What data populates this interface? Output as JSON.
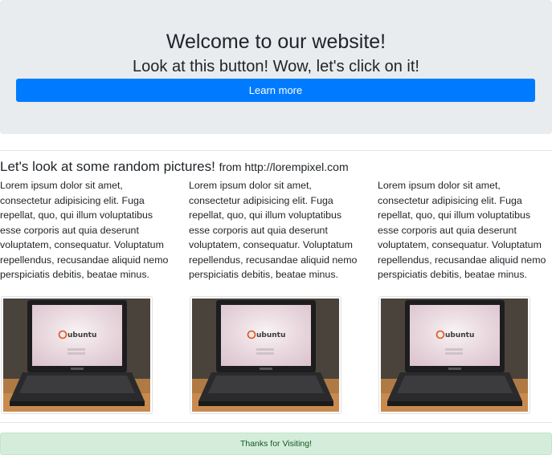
{
  "hero": {
    "title": "Welcome to our website!",
    "subtitle": "Look at this button! Wow, let's click on it!",
    "button_label": "Learn more",
    "button_color": "#007bff"
  },
  "gallery": {
    "heading": "Let's look at some random pictures!",
    "heading_source": "from http://lorempixel.com",
    "columns": [
      {
        "text": "Lorem ipsum dolor sit amet, consectetur adipisicing elit. Fuga repellat, quo, qui illum voluptatibus esse corporis aut quia deserunt voluptatem, consequatur. Voluptatum repellendus, recusandae aliquid nemo perspiciatis debitis, beatae minus.",
        "image_brand": "ubuntu"
      },
      {
        "text": "Lorem ipsum dolor sit amet, consectetur adipisicing elit. Fuga repellat, quo, qui illum voluptatibus esse corporis aut quia deserunt voluptatem, consequatur. Voluptatum repellendus, recusandae aliquid nemo perspiciatis debitis, beatae minus.",
        "image_brand": "ubuntu"
      },
      {
        "text": "Lorem ipsum dolor sit amet, consectetur adipisicing elit. Fuga repellat, quo, qui illum voluptatibus esse corporis aut quia deserunt voluptatem, consequatur. Voluptatum repellendus, recusandae aliquid nemo perspiciatis debitis, beatae minus.",
        "image_brand": "ubuntu"
      }
    ]
  },
  "footer": {
    "message": "Thanks for Visiting!",
    "alert_color": "#d4edda"
  }
}
